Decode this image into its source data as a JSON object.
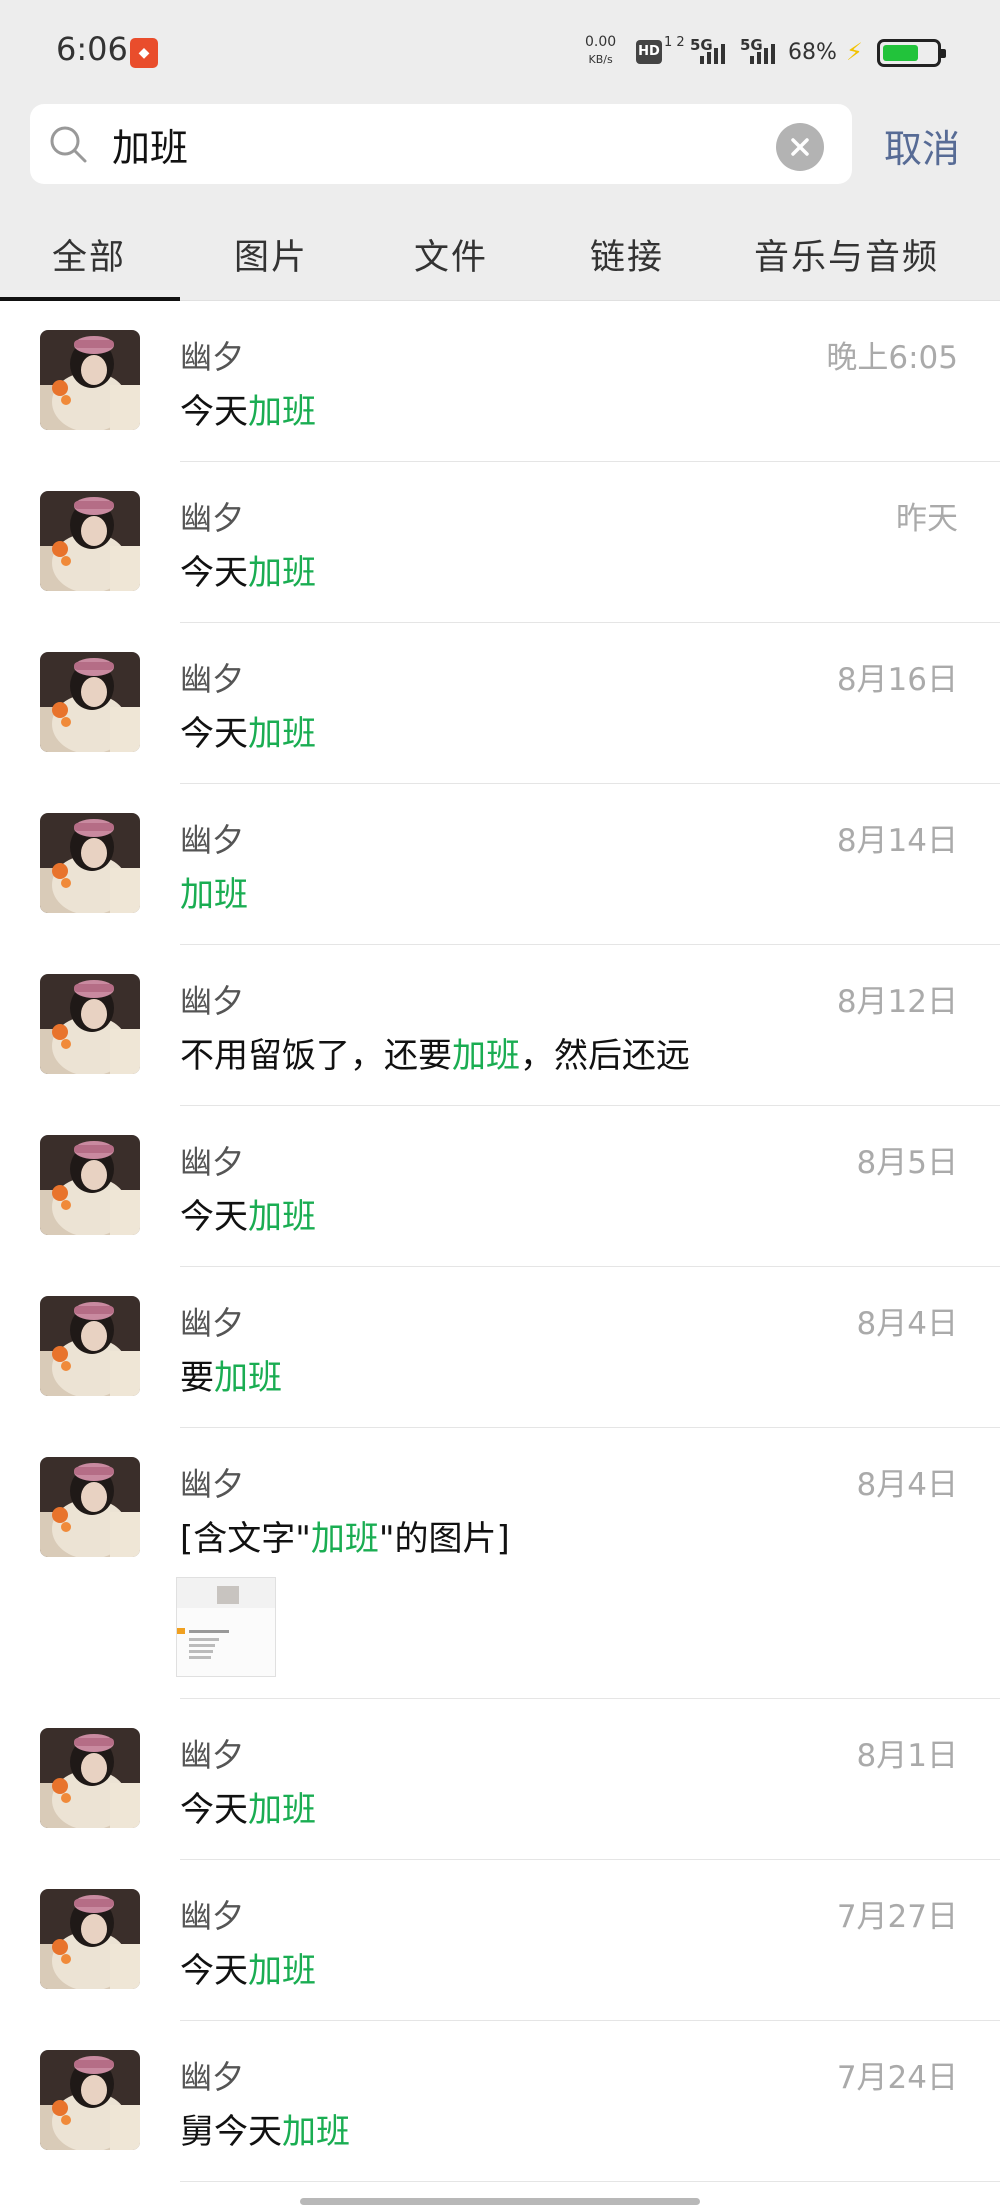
{
  "status_bar": {
    "time": "6:06",
    "app_badge_icon": "app-notification-icon",
    "net_speed": "0.00",
    "net_speed_unit": "KB/s",
    "hd": "HD",
    "hd_sub": "1 2",
    "sim1": "5G",
    "sim2": "5G",
    "battery": "68%",
    "battery_level": 0.68,
    "battery_color": "#22c33b"
  },
  "search": {
    "query": "加班",
    "cancel_label": "取消",
    "cancel_color": "#576b95"
  },
  "tabs": [
    {
      "label": "全部",
      "active": true
    },
    {
      "label": "图片"
    },
    {
      "label": "文件"
    },
    {
      "label": "链接"
    },
    {
      "label": "音乐与音频"
    }
  ],
  "highlight_color": "#1aad52",
  "results": [
    {
      "sender": "幽夕",
      "date": "晚上6:05",
      "pre": "今天",
      "hl": "加班",
      "post": ""
    },
    {
      "sender": "幽夕",
      "date": "昨天",
      "pre": "今天",
      "hl": "加班",
      "post": ""
    },
    {
      "sender": "幽夕",
      "date": "8月16日",
      "pre": "今天",
      "hl": "加班",
      "post": ""
    },
    {
      "sender": "幽夕",
      "date": "8月14日",
      "pre": "",
      "hl": "加班",
      "post": ""
    },
    {
      "sender": "幽夕",
      "date": "8月12日",
      "pre": "不用留饭了，还要",
      "hl": "加班",
      "post": "，然后还远"
    },
    {
      "sender": "幽夕",
      "date": "8月5日",
      "pre": "今天",
      "hl": "加班",
      "post": ""
    },
    {
      "sender": "幽夕",
      "date": "8月4日",
      "pre": "要",
      "hl": "加班",
      "post": ""
    },
    {
      "sender": "幽夕",
      "date": "8月4日",
      "pre": "[含文字\"",
      "hl": "加班",
      "post": "\"的图片]",
      "has_thumb": true
    },
    {
      "sender": "幽夕",
      "date": "8月1日",
      "pre": "今天",
      "hl": "加班",
      "post": ""
    },
    {
      "sender": "幽夕",
      "date": "7月27日",
      "pre": "今天",
      "hl": "加班",
      "post": ""
    },
    {
      "sender": "幽夕",
      "date": "7月24日",
      "pre": "舅今天",
      "hl": "加班",
      "post": ""
    }
  ]
}
